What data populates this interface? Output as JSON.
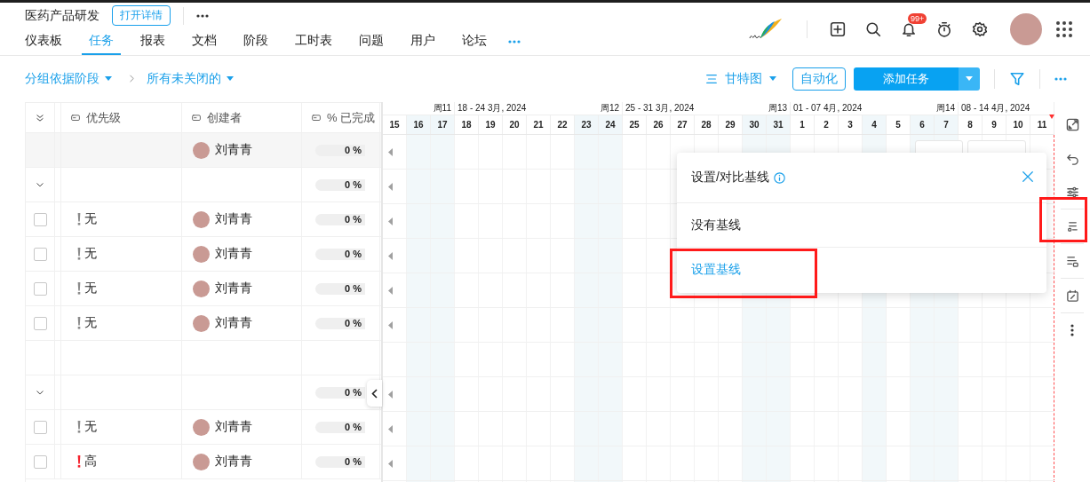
{
  "project": {
    "title": "医药产品研发",
    "details_button": "打开详情"
  },
  "nav": {
    "tabs": [
      {
        "label": "仪表板",
        "selected": false
      },
      {
        "label": "任务",
        "selected": true
      },
      {
        "label": "报表",
        "selected": false
      },
      {
        "label": "文档",
        "selected": false
      },
      {
        "label": "阶段",
        "selected": false
      },
      {
        "label": "工时表",
        "selected": false
      },
      {
        "label": "问题",
        "selected": false
      },
      {
        "label": "用户",
        "selected": false
      },
      {
        "label": "论坛",
        "selected": false
      }
    ]
  },
  "notifications": {
    "badge": "99+"
  },
  "toolbar": {
    "group_by": "分组依据阶段",
    "filter": "所有未关闭的",
    "view": "甘特图",
    "automation_button": "自动化",
    "add_task_button": "添加任务"
  },
  "table": {
    "columns": [
      "优先级",
      "创建者",
      "% 已完成"
    ],
    "rows": [
      {
        "kind": "summary",
        "creator": "刘青青",
        "percent": "0 %",
        "level": 0,
        "bar_offscreen": true
      },
      {
        "kind": "group",
        "expanded": true,
        "percent": "0 %",
        "level": 0,
        "bar_offscreen": true
      },
      {
        "kind": "task",
        "checked": false,
        "priority": "无",
        "color": "#8c8c8c",
        "creator": "刘青青",
        "percent": "0 %",
        "level": 0,
        "bar_offscreen": true
      },
      {
        "kind": "task",
        "checked": false,
        "priority": "无",
        "color": "#8c8c8c",
        "creator": "刘青青",
        "percent": "0 %",
        "level": 0,
        "bar_offscreen": true
      },
      {
        "kind": "task",
        "checked": false,
        "priority": "无",
        "color": "#8c8c8c",
        "creator": "刘青青",
        "percent": "0 %",
        "level": 0,
        "bar_offscreen": true
      },
      {
        "kind": "task",
        "checked": false,
        "priority": "无",
        "color": "#8c8c8c",
        "creator": "刘青青",
        "percent": "0 %",
        "level": 0,
        "bar_offscreen": true
      },
      {
        "kind": "empty",
        "bar_offscreen": false
      },
      {
        "kind": "group",
        "expanded": true,
        "percent": "0 %",
        "level": 0,
        "bar_offscreen": true
      },
      {
        "kind": "task",
        "checked": false,
        "priority": "无",
        "color": "#8c8c8c",
        "creator": "刘青青",
        "percent": "0 %",
        "level": 0,
        "bar_offscreen": true
      },
      {
        "kind": "task",
        "checked": false,
        "priority": "高",
        "color": "#f5222d",
        "creator": "刘青青",
        "percent": "0 %",
        "level": 0,
        "bar_offscreen": true
      }
    ]
  },
  "gantt": {
    "weeks": [
      {
        "number": "周11",
        "days": [
          {
            "label": "15",
            "shaded": false,
            "today": false
          },
          {
            "label": "16",
            "shaded": true,
            "today": false
          },
          {
            "label": "17",
            "shaded": true,
            "today": false
          }
        ]
      },
      {
        "range": "18 - 24 3月, 2024",
        "number": "周12",
        "days": [
          {
            "label": "18",
            "shaded": false,
            "today": false
          },
          {
            "label": "19",
            "shaded": false,
            "today": false
          },
          {
            "label": "20",
            "shaded": false,
            "today": false
          },
          {
            "label": "21",
            "shaded": false,
            "today": false
          },
          {
            "label": "22",
            "shaded": false,
            "today": false
          },
          {
            "label": "23",
            "shaded": true,
            "today": false
          },
          {
            "label": "24",
            "shaded": true,
            "today": false
          }
        ]
      },
      {
        "range": "25 - 31 3月, 2024",
        "number": "周13",
        "days": [
          {
            "label": "25",
            "shaded": false,
            "today": false
          },
          {
            "label": "26",
            "shaded": false,
            "today": false
          },
          {
            "label": "27",
            "shaded": false,
            "today": false
          },
          {
            "label": "28",
            "shaded": false,
            "today": false
          },
          {
            "label": "29",
            "shaded": false,
            "today": false
          },
          {
            "label": "30",
            "shaded": true,
            "today": false
          },
          {
            "label": "31",
            "shaded": true,
            "today": false
          }
        ]
      },
      {
        "range": "01 - 07 4月, 2024",
        "number": "周14",
        "days": [
          {
            "label": "1",
            "shaded": false,
            "today": false
          },
          {
            "label": "2",
            "shaded": false,
            "today": false
          },
          {
            "label": "3",
            "shaded": false,
            "today": false
          },
          {
            "label": "4",
            "shaded": true,
            "today": false
          },
          {
            "label": "5",
            "shaded": false,
            "today": false
          },
          {
            "label": "6",
            "shaded": true,
            "today": false
          },
          {
            "label": "7",
            "shaded": true,
            "today": false
          }
        ]
      },
      {
        "range": "08 - 14 4月, 2024",
        "days": [
          {
            "label": "8",
            "shaded": false,
            "today": false
          },
          {
            "label": "9",
            "shaded": false,
            "today": false
          },
          {
            "label": "10",
            "shaded": false,
            "today": false
          },
          {
            "label": "11",
            "shaded": false,
            "today": true
          }
        ]
      }
    ]
  },
  "baseline_popover": {
    "title": "设置/对比基线",
    "options": [
      {
        "label": "没有基线",
        "kind": "option"
      },
      {
        "label": "设置基线",
        "kind": "action"
      }
    ]
  }
}
